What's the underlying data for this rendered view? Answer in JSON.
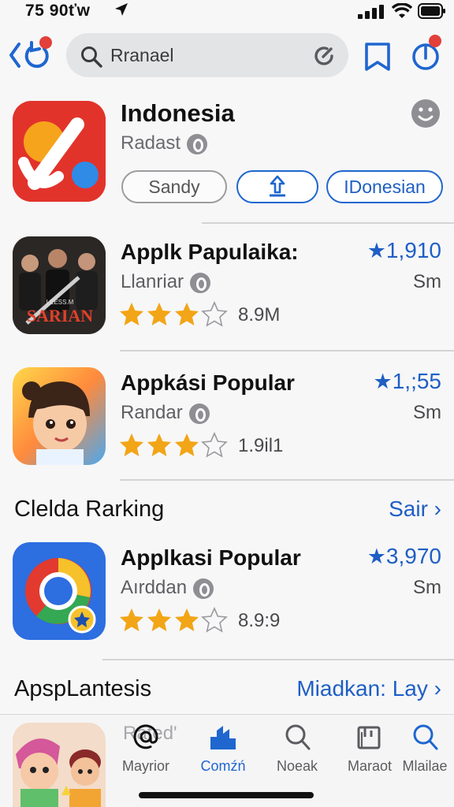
{
  "status": {
    "time": "75 90ťw"
  },
  "search": {
    "query": "Rranael"
  },
  "header_app": {
    "title": "Indonesia",
    "subtitle": "Radast",
    "buttons": {
      "left": "Sandy",
      "right": "IDonesian"
    }
  },
  "list1": [
    {
      "title": "Applk Papulaika:",
      "subtitle": "Llanriar",
      "stars": 3,
      "count": "8.9M",
      "rating": "1,910",
      "size": "Sm",
      "icon_text": "SARIAN",
      "icon_small": "LEESS.M"
    },
    {
      "title": "Appkási Popular",
      "subtitle": "Randar",
      "stars": 3,
      "count": "1.9il1",
      "rating": "1,;55",
      "size": "Sm"
    }
  ],
  "section1": {
    "heading": "Clelda Rarking",
    "link": "Sair"
  },
  "list2": [
    {
      "title": "Applkasi Popular",
      "subtitle": "Aırddan",
      "stars": 3,
      "count": "8.9:9",
      "rating": "3,970",
      "size": "Sm"
    }
  ],
  "section2": {
    "heading": "ApspLantesis",
    "link": "Miadkan: Lay"
  },
  "tabbar": {
    "ghost_label": "Rated'",
    "tabs": [
      {
        "label": "Mayrior",
        "icon": "at-icon"
      },
      {
        "label": "Comźń",
        "icon": "buildings-icon",
        "active": true
      },
      {
        "label": "Noeak",
        "icon": "search-icon"
      },
      {
        "label": "Maraot",
        "icon": "book-icon"
      },
      {
        "label": "Mlailae",
        "icon": "search-icon"
      }
    ]
  },
  "colors": {
    "accent": "#1f66cf",
    "star": "#f2a516",
    "badge": "#e2403a"
  }
}
